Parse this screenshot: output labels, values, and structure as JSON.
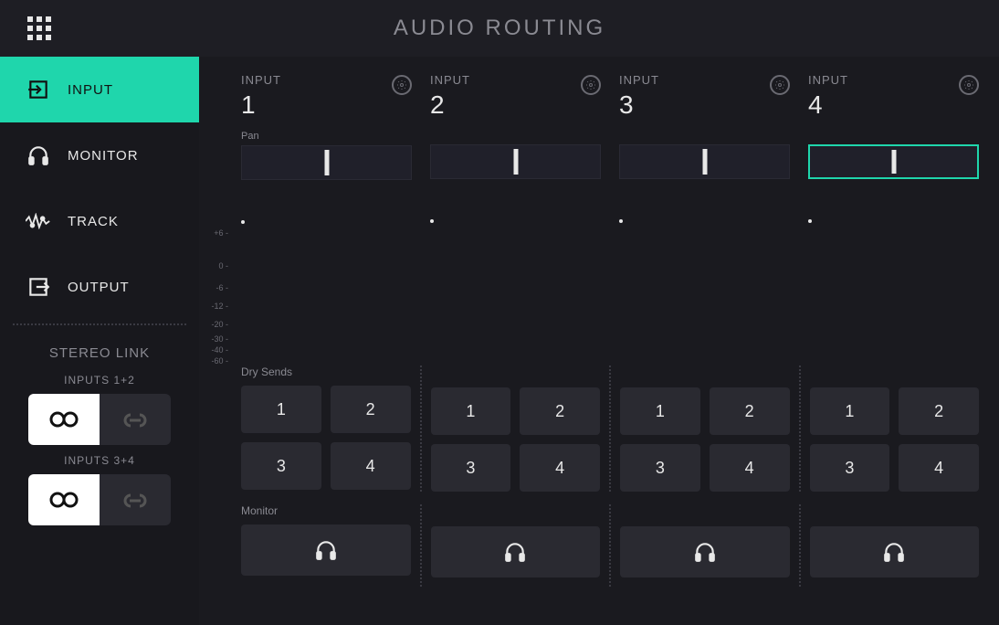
{
  "header": {
    "title": "AUDIO ROUTING"
  },
  "sidebar": {
    "items": [
      {
        "label": "INPUT",
        "icon": "input-icon",
        "active": true
      },
      {
        "label": "MONITOR",
        "icon": "headphone-icon",
        "active": false
      },
      {
        "label": "TRACK",
        "icon": "waveform-icon",
        "active": false
      },
      {
        "label": "OUTPUT",
        "icon": "output-icon",
        "active": false
      }
    ],
    "stereo_title": "STEREO LINK",
    "stereo_groups": [
      {
        "label": "INPUTS 1+2",
        "unlinked_active": true
      },
      {
        "label": "INPUTS 3+4",
        "unlinked_active": true
      }
    ]
  },
  "content": {
    "channel_label": "INPUT",
    "channels": [
      {
        "num": "1",
        "pan_pos": 0.5,
        "selected": false
      },
      {
        "num": "2",
        "pan_pos": 0.5,
        "selected": false
      },
      {
        "num": "3",
        "pan_pos": 0.5,
        "selected": false
      },
      {
        "num": "4",
        "pan_pos": 0.5,
        "selected": true
      }
    ],
    "pan_label": "Pan",
    "meter_scale": [
      "+6",
      "0",
      "-6",
      "-12",
      "-20",
      "-30",
      "-40",
      "-60"
    ],
    "sends_label": "Dry Sends",
    "send_buttons": [
      "1",
      "2",
      "3",
      "4"
    ],
    "monitor_label": "Monitor"
  }
}
